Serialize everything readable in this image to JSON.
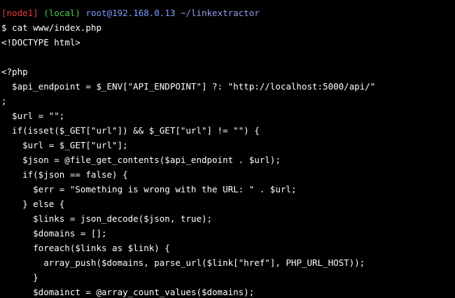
{
  "prompt": {
    "node": "[node1]",
    "env": "(local)",
    "user_host": "root@192.168.0.13",
    "path": "~/linkextractor"
  },
  "colors": {
    "background": "#000000",
    "text": "#ffffff",
    "node": "#ee3b3b",
    "env": "#46d246",
    "user_host": "#7f9fff",
    "path": "#9a9af0"
  },
  "command": "$ cat www/index.php",
  "output_lines": [
    "<!DOCTYPE html>",
    "",
    "<?php",
    "  $api_endpoint = $_ENV[\"API_ENDPOINT\"] ?: \"http://localhost:5000/api/\"",
    ";",
    "  $url = \"\";",
    "  if(isset($_GET[\"url\"]) && $_GET[\"url\"] != \"\") {",
    "    $url = $_GET[\"url\"];",
    "    $json = @file_get_contents($api_endpoint . $url);",
    "    if($json == false) {",
    "      $err = \"Something is wrong with the URL: \" . $url;",
    "    } else {",
    "      $links = json_decode($json, true);",
    "      $domains = [];",
    "      foreach($links as $link) {",
    "        array_push($domains, parse_url($link[\"href\"], PHP_URL_HOST));",
    "      }",
    "      $domainct = @array_count_values($domains);"
  ]
}
